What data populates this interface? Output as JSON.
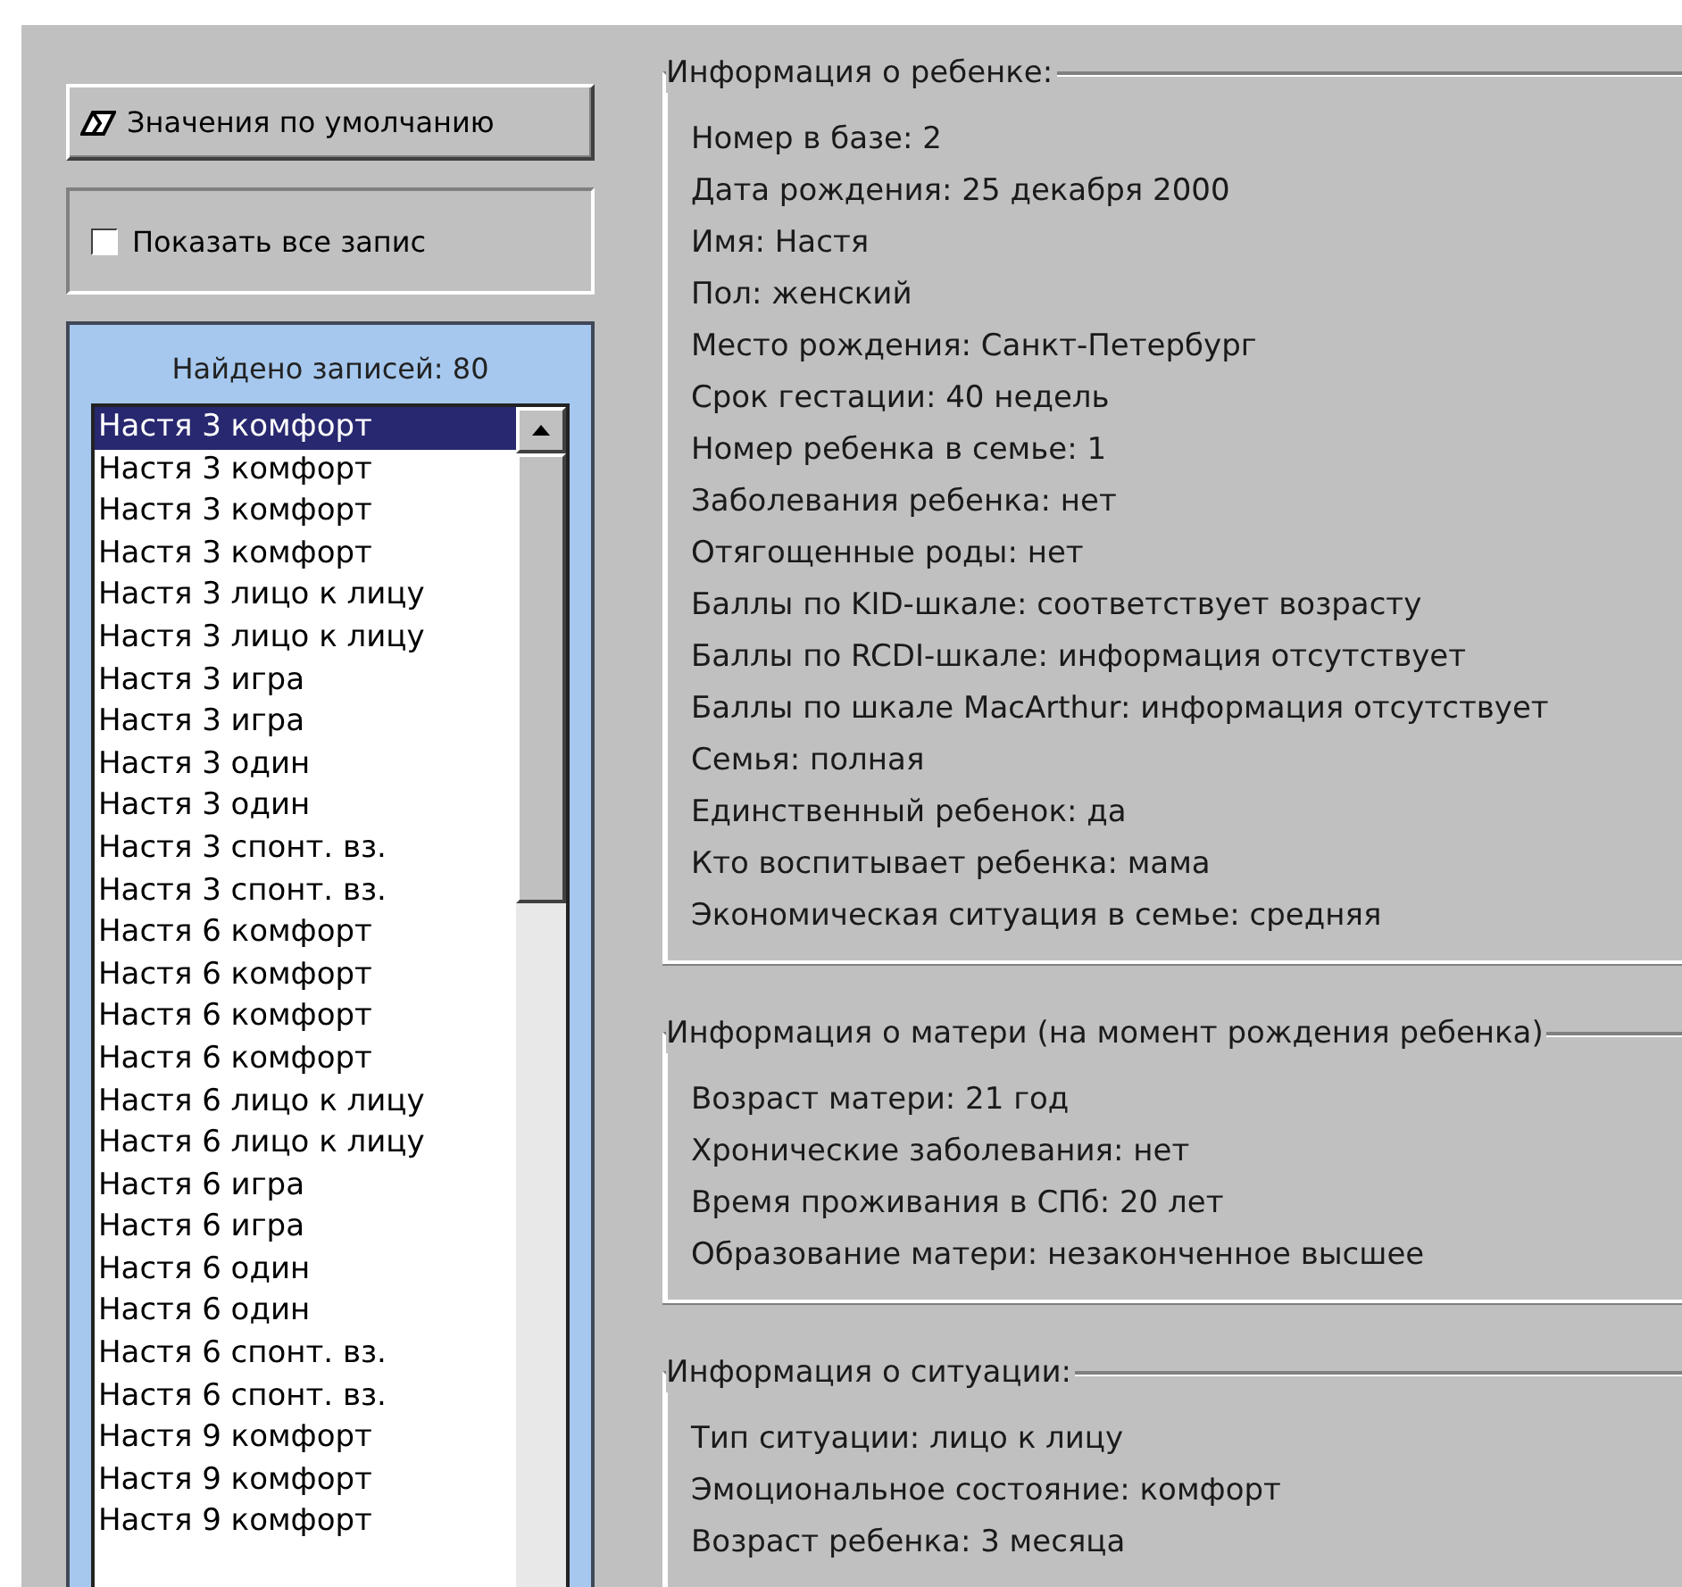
{
  "defaults_button": {
    "label": "Значения по умолчанию"
  },
  "show_all": {
    "label": "Показать все запис",
    "checked": false
  },
  "records": {
    "found": "Найдено записей: 80",
    "items": [
      {
        "label": "Настя 3 комфорт",
        "selected": true
      },
      {
        "label": "Настя 3 комфорт",
        "selected": false
      },
      {
        "label": "Настя 3 комфорт",
        "selected": false
      },
      {
        "label": "Настя 3 комфорт",
        "selected": false
      },
      {
        "label": "Настя 3 лицо к лицу",
        "selected": false
      },
      {
        "label": "Настя 3 лицо к лицу",
        "selected": false
      },
      {
        "label": "Настя 3 игра",
        "selected": false
      },
      {
        "label": "Настя 3 игра",
        "selected": false
      },
      {
        "label": "Настя 3 один",
        "selected": false
      },
      {
        "label": "Настя 3 один",
        "selected": false
      },
      {
        "label": "Настя 3 спонт. вз.",
        "selected": false
      },
      {
        "label": "Настя 3 спонт. вз.",
        "selected": false
      },
      {
        "label": "Настя 6 комфорт",
        "selected": false
      },
      {
        "label": "Настя 6 комфорт",
        "selected": false
      },
      {
        "label": "Настя 6 комфорт",
        "selected": false
      },
      {
        "label": "Настя 6 комфорт",
        "selected": false
      },
      {
        "label": "Настя 6 лицо к лицу",
        "selected": false
      },
      {
        "label": "Настя 6 лицо к лицу",
        "selected": false
      },
      {
        "label": "Настя 6 игра",
        "selected": false
      },
      {
        "label": "Настя 6 игра",
        "selected": false
      },
      {
        "label": "Настя 6 один",
        "selected": false
      },
      {
        "label": "Настя 6 один",
        "selected": false
      },
      {
        "label": "Настя 6 спонт. вз.",
        "selected": false
      },
      {
        "label": "Настя 6 спонт. вз.",
        "selected": false
      },
      {
        "label": "Настя 9 комфорт",
        "selected": false
      },
      {
        "label": "Настя 9 комфорт",
        "selected": false
      },
      {
        "label": "Настя 9 комфорт",
        "selected": false
      }
    ]
  },
  "groups": [
    {
      "title": "Информация о ребенке:",
      "lines": [
        "Номер в базе: 2",
        "Дата рождения: 25 декабря 2000",
        "Имя: Настя",
        "Пол: женский",
        "Место рождения: Санкт-Петербург",
        "Срок гестации: 40 недель",
        "Номер ребенка в семье: 1",
        "Заболевания ребенка: нет",
        "Отягощенные роды: нет",
        "Баллы по KID-шкале: соответствует возрасту",
        "Баллы по RCDI-шкале: информация отсутствует",
        "Баллы по шкале MacArthur: информация отсутствует",
        "Семья: полная",
        "Единственный ребенок: да",
        "Кто воспитывает ребенка: мама",
        "Экономическая ситуация в семье: средняя"
      ]
    },
    {
      "title": "Информация о матери (на момент рождения ребенка)",
      "lines": [
        "Возраст матери: 21 год",
        "Хронические заболевания: нет",
        "Время проживания в СПб: 20 лет",
        "Образование матери: незаконченное высшее"
      ]
    },
    {
      "title": "Информация о ситуации:",
      "lines": [
        "Тип ситуации: лицо к лицу",
        "Эмоциональное состояние: комфорт",
        "Возраст ребенка: 3 месяца"
      ]
    }
  ]
}
